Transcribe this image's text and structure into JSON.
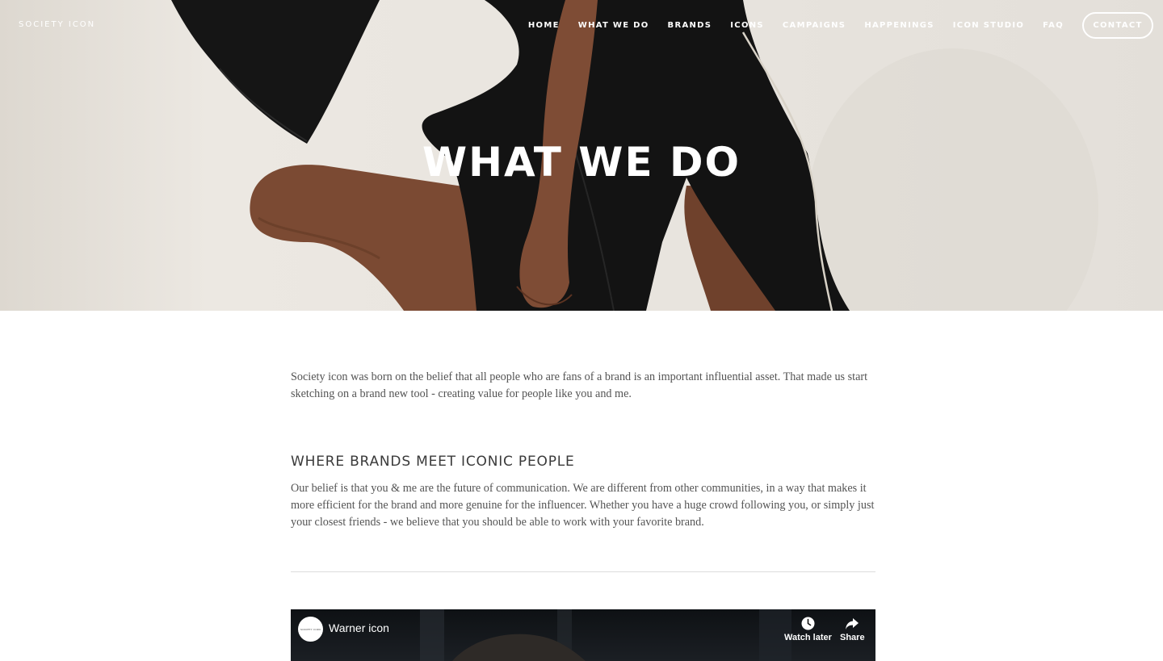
{
  "header": {
    "brand": "SOCIETY ICON",
    "nav": [
      "HOME",
      "WHAT WE DO",
      "BRANDS",
      "ICONS",
      "CAMPAIGNS",
      "HAPPENINGS",
      "ICON STUDIO",
      "FAQ"
    ],
    "contact": "CONTACT"
  },
  "hero": {
    "title": "WHAT WE DO"
  },
  "content": {
    "intro": "Society icon was born on the belief that all people who are fans of a brand is an important influential asset. That made us start sketching on a brand new tool - creating value for people like you and me.",
    "heading": "WHERE BRANDS MEET ICONIC PEOPLE",
    "body": "Our belief is that you & me are the future of communication. We are different from other communities, in a way that makes it more efficient for the brand and more genuine for the influencer. Whether you have a huge crowd following you, or simply just your closest friends - we believe that you should be able to work with your favorite brand."
  },
  "video": {
    "title": "Warner icon",
    "channel_logo_text": "SOCIETY ICON",
    "watch_later": "Watch later",
    "share": "Share"
  },
  "colors": {
    "hero_background": "#e9e5df",
    "dress": "#141414",
    "skin": "#7a4a33",
    "text": "#545454",
    "heading": "#3a3a3a"
  }
}
